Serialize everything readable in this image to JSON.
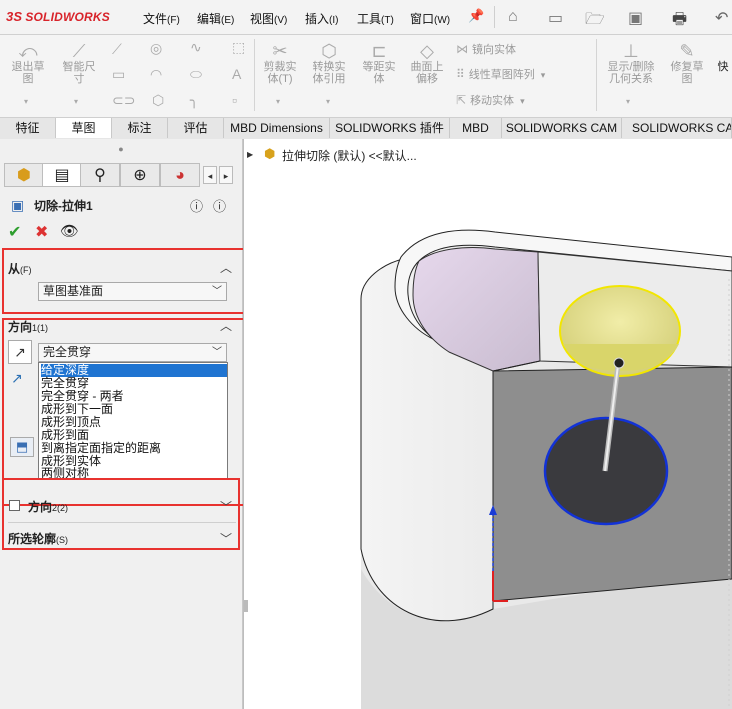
{
  "app": {
    "logo_text": "SOLIDWORKS",
    "logo_mark": "3S"
  },
  "menu": [
    {
      "label": "文件",
      "accel": "(F)"
    },
    {
      "label": "编辑",
      "accel": "(E)"
    },
    {
      "label": "视图",
      "accel": "(V)"
    },
    {
      "label": "插入",
      "accel": "(I)"
    },
    {
      "label": "工具",
      "accel": "(T)"
    },
    {
      "label": "窗口",
      "accel": "(W)"
    }
  ],
  "commands": {
    "exit_sketch": "退出草\n图",
    "smart_dim": "智能尺\n寸",
    "trim": "剪裁实\n体(T)",
    "convert": "转换实\n体引用",
    "offset": "等距实\n体",
    "offset_surface": "曲面上\n偏移",
    "mirror": "镜向实体",
    "linear_pattern": "线性草图阵列",
    "move": "移动实体",
    "show_relations": "显示/删除\n几何关系",
    "repair": "修复草\n图",
    "quick": "快"
  },
  "tabs": [
    "特征",
    "草图",
    "标注",
    "评估",
    "MBD Dimensions",
    "SOLIDWORKS 插件",
    "MBD",
    "SOLIDWORKS CAM",
    "SOLIDWORKS CAM"
  ],
  "active_tab": "草图",
  "panel": {
    "feature_title": "切除-拉伸1",
    "from": {
      "label": "从",
      "accel": "(F)",
      "value": "草图基准面"
    },
    "direction1": {
      "label": "方向",
      "accel": "1(1)",
      "value": "完全贯穿",
      "options": [
        "给定深度",
        "完全贯穿",
        "完全贯穿 - 两者",
        "成形到下一面",
        "成形到顶点",
        "成形到面",
        "到离指定面指定的距离",
        "成形到实体",
        "两侧对称"
      ],
      "selected_index": 0
    },
    "direction2": {
      "label": "方向",
      "accel": "2(2)"
    },
    "contours": {
      "label": "所选轮廓",
      "accel": "(S)"
    }
  },
  "graphics": {
    "breadcrumb": "拉伸切除 (默认) <<默认..."
  },
  "colors": {
    "highlight_red": "#e8322f",
    "selection_blue": "#1f74d1",
    "brand_red": "#d8232a",
    "ok_green": "#2e9e2e"
  }
}
